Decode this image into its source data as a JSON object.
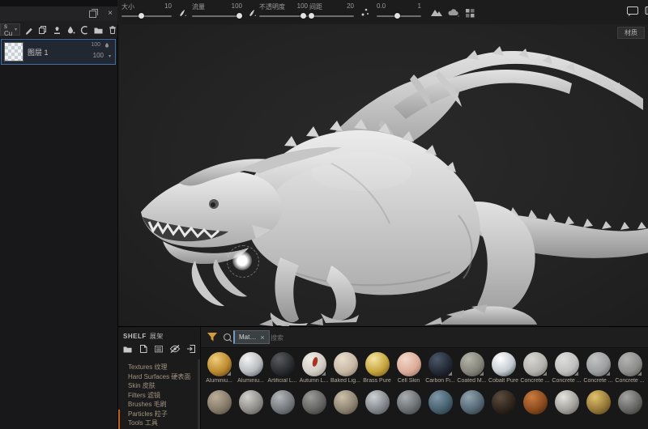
{
  "topbar": {
    "sliders": [
      {
        "label": "大小",
        "value": "10",
        "pos": 38
      },
      {
        "label": "流量",
        "value": "100",
        "pos": 94
      },
      {
        "label": "不透明度",
        "value": "100",
        "pos": 90
      },
      {
        "label": "间距",
        "value": "20",
        "pos": 3
      },
      {
        "label": "0.0",
        "value": "1",
        "pos": 46
      }
    ],
    "icon_names": [
      "brush-falloff",
      "brush-falloff",
      "scatter",
      "mountain",
      "cloud",
      "grid",
      "display",
      "panel-edge"
    ]
  },
  "viewport": {
    "view_mode_label": "材质",
    "model": "white dragon sculpt",
    "cursor": "brush-glow"
  },
  "layers_panel": {
    "blend_mode": "s Cu",
    "tool_icon_names": [
      "pen",
      "copy",
      "stamp",
      "fill-drop",
      "curve",
      "folder",
      "trash"
    ],
    "header_icon_names": [
      "float-window",
      "close"
    ],
    "layer_name": "图层 1",
    "opacity_top": "100",
    "opacity_bottom": "100"
  },
  "shelf": {
    "title": "SHELF",
    "title_zh": "展架",
    "toolbar_icon_names": [
      "folder",
      "new-page",
      "stack",
      "eye-off",
      "import"
    ],
    "categories": [
      "Textures 纹理",
      "Hard Surfaces 硬表面",
      "Skin 皮肤",
      "Filters 滤镜",
      "Brushes 毛刷",
      "Particles 粒子",
      "Tools 工具"
    ],
    "filter_icon_names": [
      "funnel",
      "search"
    ],
    "filter_chip_label": "Mat…",
    "search_placeholder": "搜索",
    "accent_color": "#bf5f1e",
    "funnel_color": "#d59a3b",
    "materials": [
      {
        "name": "Aluminiu...",
        "hi": "#f0cd7a",
        "base": "#bd8a30",
        "dark": "#5a3c12",
        "badge": true
      },
      {
        "name": "Aluminiu...",
        "hi": "#f4f4f4",
        "base": "#b9bcbf",
        "dark": "#505459"
      },
      {
        "name": "Artificial L...",
        "hi": "#5a5b60",
        "base": "#2c2d30",
        "dark": "#0d0d10"
      },
      {
        "name": "Autumn L...",
        "hi": "#f0ede7",
        "base": "#d2cdc5",
        "dark": "#8f8a82",
        "leaf": "#a53420",
        "badge": true
      },
      {
        "name": "Baked Lig...",
        "hi": "#e9ddcc",
        "base": "#c7b8a5",
        "dark": "#7c705e"
      },
      {
        "name": "Brass Pure",
        "hi": "#f4e5a2",
        "base": "#c7a43e",
        "dark": "#6b5415"
      },
      {
        "name": "Cell Skin",
        "hi": "#f2d8ca",
        "base": "#dcac9a",
        "dark": "#8f6a5c"
      },
      {
        "name": "Carbon Fi...",
        "hi": "#4c5869",
        "base": "#242b37",
        "dark": "#0a0d13",
        "badge": true
      },
      {
        "name": "Coated M...",
        "hi": "#b5b5aa",
        "base": "#85857b",
        "dark": "#494941",
        "badge": true
      },
      {
        "name": "Cobalt Pure",
        "hi": "#ffffff",
        "base": "#c4cad0",
        "dark": "#3d444c"
      },
      {
        "name": "Concrete ...",
        "hi": "#d8d6d1",
        "base": "#b4b2ad",
        "dark": "#6e6c67",
        "badge": true
      },
      {
        "name": "Concrete ...",
        "hi": "#dededc",
        "base": "#c0c1bf",
        "dark": "#767779",
        "badge": true
      },
      {
        "name": "Concrete ...",
        "hi": "#c2c3c3",
        "base": "#9d9e9f",
        "dark": "#5c5d5f",
        "badge": true
      },
      {
        "name": "Concrete ...",
        "hi": "#b4b4b2",
        "base": "#8d8d8b",
        "dark": "#4f4f4d",
        "badge": true
      }
    ],
    "materials_row2": [
      {
        "hi": "#bcae9a",
        "base": "#867b69",
        "dark": "#4f4639"
      },
      {
        "hi": "#d2d1ce",
        "base": "#908f8c",
        "dark": "#535250"
      },
      {
        "hi": "#b6b9bc",
        "base": "#76797d",
        "dark": "#3f4245"
      },
      {
        "hi": "#9c9c9a",
        "base": "#646462",
        "dark": "#333331"
      },
      {
        "hi": "#ccc1aa",
        "base": "#8e8473",
        "dark": "#51483b"
      },
      {
        "hi": "#cfd2d5",
        "base": "#85888c",
        "dark": "#484b4f"
      },
      {
        "hi": "#aaaeb1",
        "base": "#6c7073",
        "dark": "#383b3e"
      },
      {
        "hi": "#8098a8",
        "base": "#47616f",
        "dark": "#1f3039"
      },
      {
        "hi": "#91a4b0",
        "base": "#576974",
        "dark": "#27333b"
      },
      {
        "hi": "#5c4c3e",
        "base": "#2f251c",
        "dark": "#120d08"
      },
      {
        "hi": "#c97c40",
        "base": "#8b4b1e",
        "dark": "#46220a"
      },
      {
        "hi": "#e6e4de",
        "base": "#a4a29c",
        "dark": "#5d5b56"
      },
      {
        "hi": "#e0c26c",
        "base": "#987a3b",
        "dark": "#4f3c15"
      },
      {
        "hi": "#a5a5a3",
        "base": "#676765",
        "dark": "#333331"
      }
    ]
  }
}
